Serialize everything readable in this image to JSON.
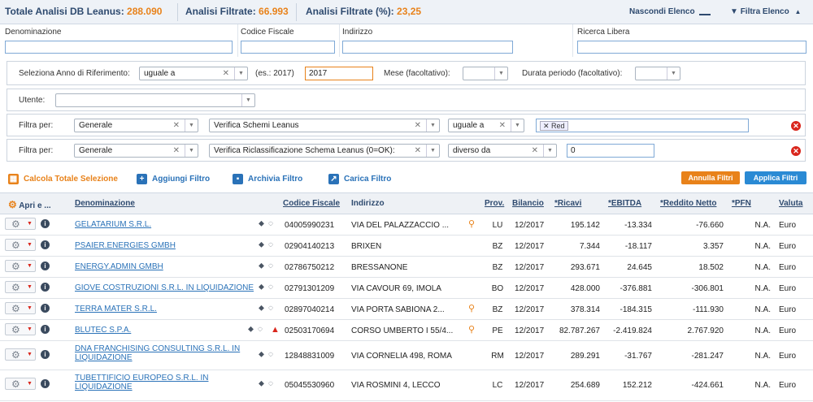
{
  "topbar": {
    "total_label": "Totale Analisi DB Leanus:",
    "total_value": "288.090",
    "filtered_label": "Analisi Filtrate:",
    "filtered_value": "66.993",
    "pct_label": "Analisi Filtrate (%):",
    "pct_value": "23,25",
    "hide_list": "Nascondi Elenco",
    "filter_list": "Filtra Elenco"
  },
  "search": {
    "denominazione": "Denominazione",
    "codice_fiscale": "Codice Fiscale",
    "indirizzo": "Indirizzo",
    "ricerca_libera": "Ricerca Libera"
  },
  "year_filter": {
    "label": "Seleziona Anno di Riferimento:",
    "operator": "uguale a",
    "example": "(es.: 2017)",
    "year": "2017",
    "month_label": "Mese (facoltativo):",
    "duration_label": "Durata periodo (facoltativo):"
  },
  "user_filter": {
    "label": "Utente:"
  },
  "filters": [
    {
      "label": "Filtra per:",
      "group": "Generale",
      "field": "Verifica Schemi Leanus",
      "operator": "uguale a",
      "value_tag": "Red"
    },
    {
      "label": "Filtra per:",
      "group": "Generale",
      "field": "Verifica Riclassificazione Schema Leanus (0=OK):",
      "operator": "diverso da",
      "value": "0"
    }
  ],
  "actions": {
    "calcola": "Calcola Totale Selezione",
    "aggiungi": "Aggiungi Filtro",
    "archivia": "Archivia Filtro",
    "carica": "Carica Filtro",
    "annulla": "Annulla Filtri",
    "applica": "Applica Filtri"
  },
  "table": {
    "headers": {
      "apri": "Apri e ...",
      "denominazione": "Denominazione",
      "codice_fiscale": "Codice Fiscale",
      "indirizzo": "Indirizzo",
      "prov": "Prov.",
      "bilancio": "Bilancio",
      "ricavi": "*Ricavi",
      "ebitda": "*EBITDA",
      "reddito": "*Reddito Netto",
      "pfn": "*PFN",
      "valuta": "Valuta"
    },
    "rows": [
      {
        "name": "GELATARIUM S.R.L.",
        "cf": "04005990231",
        "addr": "VIA DEL PALAZZACCIO ...",
        "prov": "LU",
        "bil": "12/2017",
        "ricavi": "195.142",
        "ebitda": "-13.334",
        "reddito": "-76.660",
        "pfn": "N.A.",
        "valuta": "Euro"
      },
      {
        "name": "PSAIER.ENERGIES GMBH",
        "cf": "02904140213",
        "addr": "BRIXEN",
        "prov": "BZ",
        "bil": "12/2017",
        "ricavi": "7.344",
        "ebitda": "-18.117",
        "reddito": "3.357",
        "pfn": "N.A.",
        "valuta": "Euro"
      },
      {
        "name": "ENERGY.ADMIN GMBH",
        "cf": "02786750212",
        "addr": "BRESSANONE",
        "prov": "BZ",
        "bil": "12/2017",
        "ricavi": "293.671",
        "ebitda": "24.645",
        "reddito": "18.502",
        "pfn": "N.A.",
        "valuta": "Euro"
      },
      {
        "name": "GIOVE COSTRUZIONI S.R.L. IN LIQUIDAZIONE",
        "cf": "02791301209",
        "addr": "VIA CAVOUR 69, IMOLA",
        "prov": "BO",
        "bil": "12/2017",
        "ricavi": "428.000",
        "ebitda": "-376.881",
        "reddito": "-306.801",
        "pfn": "N.A.",
        "valuta": "Euro"
      },
      {
        "name": "TERRA MATER S.R.L.",
        "cf": "02897040214",
        "addr": "VIA PORTA SABIONA 2...",
        "prov": "BZ",
        "bil": "12/2017",
        "ricavi": "378.314",
        "ebitda": "-184.315",
        "reddito": "-111.930",
        "pfn": "N.A.",
        "valuta": "Euro"
      },
      {
        "name": "BLUTEC S.P.A.",
        "cf": "02503170694",
        "addr": "CORSO UMBERTO I 55/4...",
        "prov": "PE",
        "bil": "12/2017",
        "ricavi": "82.787.267",
        "ebitda": "-2.419.824",
        "reddito": "2.767.920",
        "pfn": "N.A.",
        "valuta": "Euro"
      },
      {
        "name_l1": "DNA FRANCHISING CONSULTING S.R.L. IN",
        "name_l2": "LIQUIDAZIONE",
        "cf": "12848831009",
        "addr": "VIA CORNELIA 498, ROMA",
        "prov": "RM",
        "bil": "12/2017",
        "ricavi": "289.291",
        "ebitda": "-31.767",
        "reddito": "-281.247",
        "pfn": "N.A.",
        "valuta": "Euro"
      },
      {
        "name_l1": "TUBETTIFICIO EUROPEO S.R.L. IN",
        "name_l2": "LIQUIDAZIONE",
        "cf": "05045530960",
        "addr": "VIA ROSMINI 4, LECCO",
        "prov": "LC",
        "bil": "12/2017",
        "ricavi": "254.689",
        "ebitda": "152.212",
        "reddito": "-424.661",
        "pfn": "N.A.",
        "valuta": "Euro"
      }
    ]
  },
  "colors": {
    "accent": "#e8821a",
    "primary": "#2e4a6f",
    "link": "#2a72b8",
    "danger": "#d9261c",
    "apply": "#2a8ad4"
  }
}
